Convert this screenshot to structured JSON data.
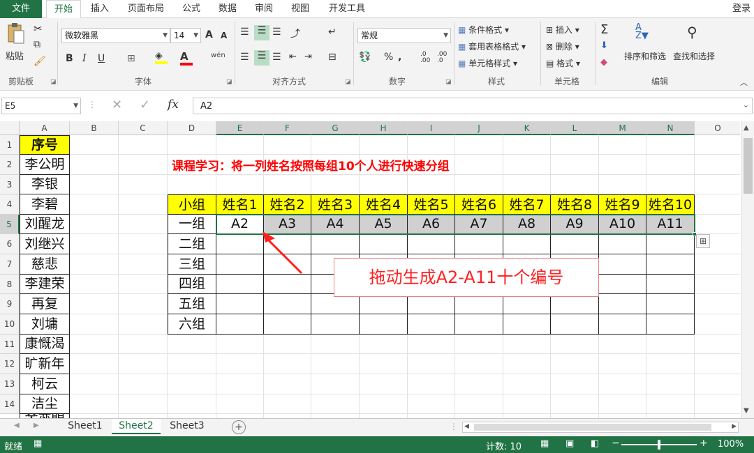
{
  "tabs": {
    "file": "文件",
    "home": "开始",
    "insert": "插入",
    "layout": "页面布局",
    "formulas": "公式",
    "data": "数据",
    "review": "审阅",
    "view": "视图",
    "developer": "开发工具",
    "login": "登录"
  },
  "ribbon": {
    "clipboard": {
      "paste": "粘贴",
      "label": "剪贴板"
    },
    "font": {
      "name": "微软雅黑",
      "size": "14",
      "bold": "B",
      "italic": "I",
      "underline": "U",
      "grow": "A",
      "shrink": "A",
      "label": "字体"
    },
    "alignment": {
      "label": "对齐方式"
    },
    "number": {
      "format": "常规",
      "label": "数字"
    },
    "styles": {
      "conditional": "条件格式",
      "table": "套用表格格式",
      "cell": "单元格样式",
      "label": "样式"
    },
    "cells": {
      "insert": "插入",
      "delete": "删除",
      "format": "格式",
      "label": "单元格"
    },
    "editing": {
      "sort": "排序和筛选",
      "find": "查找和选择",
      "label": "编辑"
    }
  },
  "formula_bar": {
    "namebox": "E5",
    "content": "A2"
  },
  "columns": [
    "A",
    "B",
    "C",
    "D",
    "E",
    "F",
    "G",
    "H",
    "I",
    "J",
    "K",
    "L",
    "M",
    "N",
    "O"
  ],
  "rows": [
    "1",
    "2",
    "3",
    "4",
    "5",
    "6",
    "7",
    "8",
    "9",
    "10",
    "11",
    "12",
    "13",
    "14"
  ],
  "column_a": [
    "序号",
    "李公明",
    "李银",
    "李碧",
    "刘醒龙",
    "刘继兴",
    "慈悲",
    "李建荣",
    "再复",
    "刘墉",
    "康慨渴",
    "旷新年",
    "柯云",
    "洁尘",
    "金亦明"
  ],
  "title": "课程学习：将一列姓名按照每组10个人进行快速分组",
  "table_header": [
    "小组",
    "姓名1",
    "姓名2",
    "姓名3",
    "姓名4",
    "姓名5",
    "姓名6",
    "姓名7",
    "姓名8",
    "姓名9",
    "姓名10"
  ],
  "groups": [
    "一组",
    "二组",
    "三组",
    "四组",
    "五组",
    "六组"
  ],
  "row5_values": [
    "A2",
    "A3",
    "A4",
    "A5",
    "A6",
    "A7",
    "A8",
    "A9",
    "A10",
    "A11"
  ],
  "annotation": "拖动生成A2-A11十个编号",
  "sheets": [
    "Sheet1",
    "Sheet2",
    "Sheet3"
  ],
  "status": {
    "ready": "就绪",
    "count": "计数: 10",
    "zoom": "100%"
  },
  "colors": {
    "accent": "#217346",
    "header_yellow": "#ffff00",
    "title_red": "#ff0000",
    "selection_gray": "#d0d0d0"
  }
}
